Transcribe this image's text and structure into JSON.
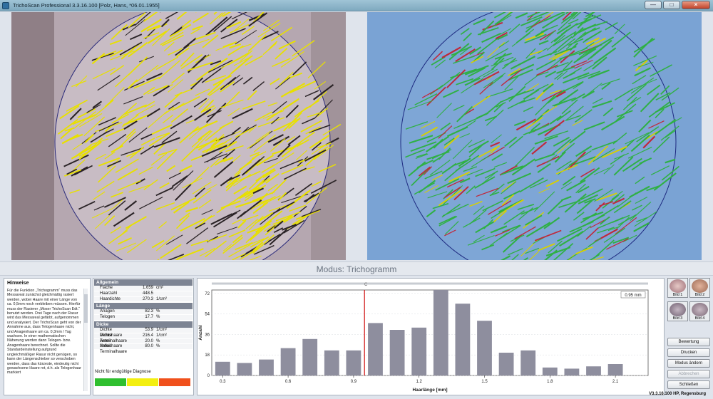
{
  "window": {
    "title": "TrichoScan Professional 3.3.16.100 [Polz, Hans, *06.01.1955]",
    "min": "—",
    "max": "□",
    "close": "×"
  },
  "modus": "Modus: Trichogramm",
  "hinweise": {
    "title": "Hinweise",
    "text": "Für die Funktion „Trichogramm“ muss das Messareal zunächst gleichmäßig rasiert werden, wobei Haare mit einer Länge von ca. 0,5mm noch verbleiben müssen. Hierfür muss der Rasierer „Moser TrichoScan Edt.“ benutzt werden. Drei Tage nach der Rasur wird das Messareal gefärbt, aufgenommen und analysiert. Der TrichoScan geht von der Annahme aus, dass Telogenhaare nicht, und Anagenhaare um ca. 0,3mm / Tag wachsen. In einer mathematischen Näherung werden dann Telogen- bzw. Anagenhaare berechnet. Sollte die Standardeinstellung aufgrund ungleichmäßiger Rasur nicht genügen, so kann der Längenschieber so verschoben werden, dass das kürzeste, eindeutig nicht gewachsene Haare rot, d.h. als Telogenhaar markiert"
  },
  "werte": {
    "allgemein": {
      "title": "Allgemein",
      "rows": [
        {
          "l": "Fläche",
          "v": "1.659",
          "u": "cm²"
        },
        {
          "l": "Haarzahl",
          "v": "448.5",
          "u": ""
        },
        {
          "l": "Haardichte",
          "v": "270.3",
          "u": "1/cm²"
        }
      ]
    },
    "laenge": {
      "title": "Länge",
      "rows": [
        {
          "l": "Anagen",
          "v": "82.3",
          "u": "%"
        },
        {
          "l": "Telogen",
          "v": "17.7",
          "u": "%"
        }
      ]
    },
    "dicke": {
      "title": "Dicke",
      "rows": [
        {
          "l": "Dichte Vellushaare",
          "v": "53.9",
          "u": "1/cm²"
        },
        {
          "l": "Dichte Terminalhaare",
          "v": "216.4",
          "u": "1/cm²"
        },
        {
          "l": "Anteil Vellushaare",
          "v": "20.0",
          "u": "%"
        },
        {
          "l": "Anteil Terminalhaare",
          "v": "80.0",
          "u": "%"
        }
      ]
    },
    "diagnose": "Nicht für endgültige Diagnose",
    "colors": [
      "#2fbf2f",
      "#f3ef10",
      "#f0501c"
    ]
  },
  "chart_data": {
    "type": "bar",
    "x": [
      0.3,
      0.4,
      0.5,
      0.6,
      0.7,
      0.8,
      0.9,
      1.0,
      1.1,
      1.2,
      1.3,
      1.4,
      1.5,
      1.6,
      1.7,
      1.8,
      1.9,
      2.0,
      2.1
    ],
    "values": [
      12,
      11,
      14,
      24,
      32,
      22,
      22,
      46,
      40,
      42,
      75,
      63,
      48,
      20,
      22,
      7,
      6,
      8,
      10
    ],
    "xlabel": "Haarlänge [mm]",
    "ylabel": "Anzahl",
    "xticks": [
      "0.3",
      "0.6",
      "0.9",
      "1.2",
      "1.5",
      "1.8",
      "2.1"
    ],
    "yticks": [
      "0",
      "18",
      "36",
      "54",
      "72"
    ],
    "xlim": [
      0.25,
      2.25
    ],
    "ylim": [
      0,
      75
    ],
    "cutoff": 0.95,
    "cutoff_label": "0.95 mm",
    "slider_label": "C",
    "bar_color": "#8e8e9e",
    "cutoff_color": "#d01010"
  },
  "thumbs": [
    "Bild 1",
    "Bild 2",
    "Bild 3",
    "Bild 4"
  ],
  "buttons": {
    "bewertung": "Bewertung",
    "drucken": "Drucken",
    "modus": "Modus ändern",
    "abbrechen": "Abbrechen",
    "schliessen": "Schließen"
  },
  "status": {
    "version": "V3.3.16.100   HP, Regensburg"
  }
}
